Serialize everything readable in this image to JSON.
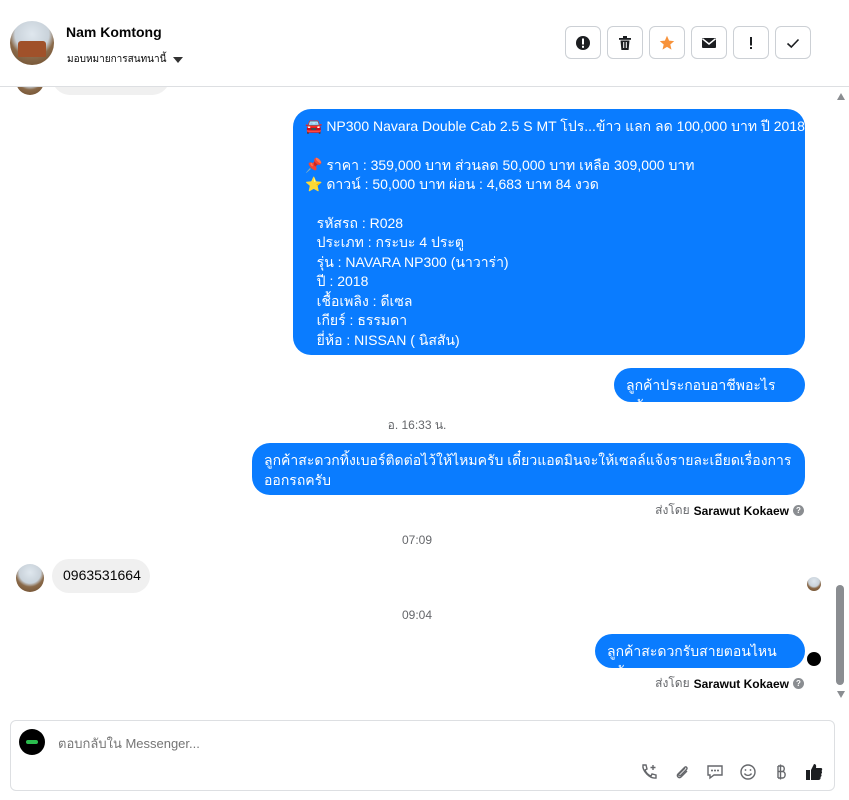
{
  "header": {
    "name": "Nam Komtong",
    "assign_label": "มอบหมายการสนทนานี้"
  },
  "toolbar": [
    {
      "name": "spam-button",
      "icon": "alert-circle-icon"
    },
    {
      "name": "delete-button",
      "icon": "trash-icon"
    },
    {
      "name": "star-button",
      "icon": "star-icon"
    },
    {
      "name": "mark-unread-button",
      "icon": "envelope-icon"
    },
    {
      "name": "follow-up-button",
      "icon": "exclamation-icon"
    },
    {
      "name": "done-button",
      "icon": "check-icon"
    }
  ],
  "messages": {
    "listing": {
      "title": "🚘 NP300 Navara Double Cab 2.5 S MT โปร...ข้าว แลก ลด 100,000 บาท ปี 2018",
      "price": "📌 ราคา : 359,000 บาท ส่วนลด 50,000 บาท เหลือ 309,000 บาท",
      "down": "⭐ ดาวน์ : 50,000 บาท ผ่อน : 4,683 บาท 84 งวด",
      "code": "   รหัสรถ : R028",
      "type": "   ประเภท : กระบะ 4 ประตู",
      "model": "   รุ่น : NAVARA NP300 (นาวาร่า)",
      "year": "   ปี : 2018",
      "fuel": "   เชื้อเพลิง : ดีเซล",
      "gear": "   เกียร์ : ธรรมดา",
      "brand": "   ยี่ห้อ : NISSAN ( นิสสัน)"
    },
    "ask_job": "ลูกค้าประกอบอาชีพอะไรครับ",
    "ts1": "อ. 16:33 น.",
    "ask_phone_line1": "ลูกค้าสะดวกทิ้งเบอร์ติดต่อไว้ให้ไหมครับ เดี๋ยวแอดมินจะให้เซลล์แจ้งรายละเอียดเรื่องการ",
    "ask_phone_line2": "ออกรถครับ",
    "sent_by_label": "ส่งโดย",
    "sender": "Sarawut Kokaew",
    "ts2": "07:09",
    "customer_reply": "0963531664",
    "ts3": "09:04",
    "ask_time": "ลูกค้าสะดวกรับสายตอนไหนครับ"
  },
  "composer": {
    "placeholder": "ตอบกลับใน Messenger..."
  },
  "composer_icons": [
    "phone-plus-icon",
    "paperclip-icon",
    "chat-bubble-icon",
    "emoji-icon",
    "baht-icon",
    "thumbs-up-icon"
  ],
  "colors": {
    "outgoing_bubble": "#0a7cff",
    "incoming_bubble": "#f0f0f0",
    "star": "#f7923a"
  }
}
